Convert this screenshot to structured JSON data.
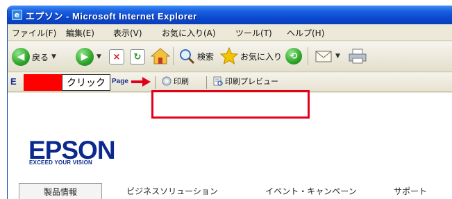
{
  "window": {
    "title": "エプソン - Microsoft Internet Explorer",
    "icon": "ie-page-icon"
  },
  "menubar": [
    "ファイル(F)",
    "編集(E)",
    "表示(V)",
    "お気に入り(A)",
    "ツール(T)",
    "ヘルプ(H)"
  ],
  "toolbar": {
    "back_label": "戻る",
    "search_label": "検索",
    "favorites_label": "お気に入り"
  },
  "linkbar": {
    "prefix": "E",
    "callout": "クリック",
    "page_label": "Page",
    "print_label": "印刷",
    "preview_label": "印刷プレビュー"
  },
  "content": {
    "logo": "EPSON",
    "tagline": "EXCEED YOUR VISION",
    "nav": [
      "製品情報",
      "ビジネスソリューション",
      "イベント・キャンペーン",
      "サポート"
    ]
  },
  "colors": {
    "highlight": "#e3001b",
    "brand": "#0c2a8d",
    "titlebar": "#0b3fb5"
  }
}
